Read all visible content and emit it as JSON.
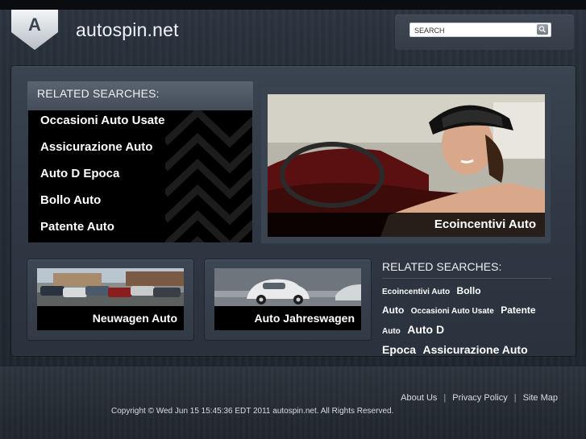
{
  "header": {
    "logo_letter": "A",
    "site_title": "autospin.net"
  },
  "search": {
    "placeholder": "SEARCH",
    "button_icon": "search-icon"
  },
  "related_searches_left": {
    "heading": "RELATED SEARCHES:",
    "items": [
      "Occasioni Auto Usate",
      "Assicurazione Auto",
      "Auto D Epoca",
      "Bollo Auto",
      "Patente Auto"
    ]
  },
  "hero": {
    "caption": "Ecoincentivi Auto"
  },
  "thumbs": [
    {
      "caption": "Neuwagen Auto"
    },
    {
      "caption": "Auto Jahreswagen"
    }
  ],
  "related_searches_right": {
    "heading": "RELATED SEARCHES:",
    "tags": [
      {
        "text": "Ecoincentivi Auto",
        "size": "s"
      },
      {
        "text": "Bollo",
        "size": "m"
      },
      {
        "text": "Auto",
        "size": "m"
      },
      {
        "text": "Occasioni Auto Usate",
        "size": "s"
      },
      {
        "text": "Patente",
        "size": "m"
      },
      {
        "text": "Auto",
        "size": "s"
      },
      {
        "text": "Auto D",
        "size": "l"
      },
      {
        "text": "Epoca",
        "size": "l"
      },
      {
        "text": "Assicurazione Auto",
        "size": "l"
      }
    ]
  },
  "footer": {
    "links": [
      "About Us",
      "Privacy Policy",
      "Site Map"
    ],
    "separator": "|",
    "copyright": "Copyright © Wed Jun 15 15:45:36 EDT 2011 autospin.net. All Rights Reserved."
  },
  "colors": {
    "background": "#262e38",
    "panel": "#2f3844",
    "list_bg": "#000000",
    "text": "#ffffff"
  }
}
